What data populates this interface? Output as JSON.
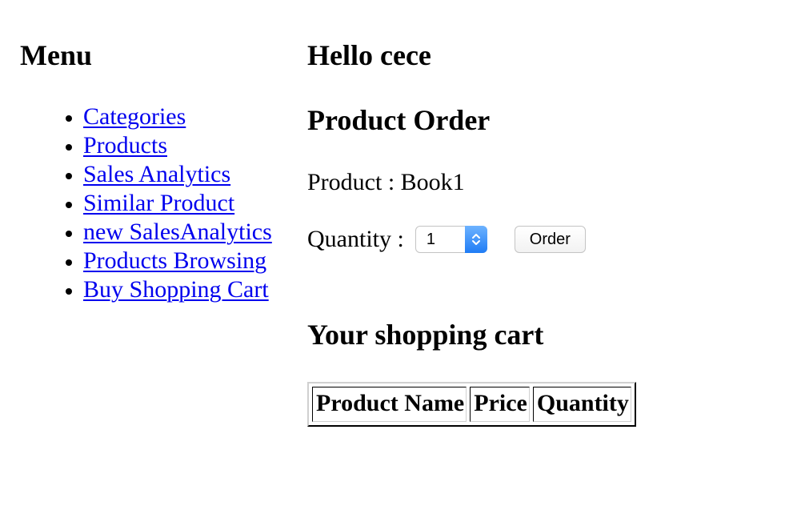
{
  "sidebar": {
    "title": "Menu",
    "items": [
      {
        "label": "Categories"
      },
      {
        "label": "Products"
      },
      {
        "label": "Sales Analytics"
      },
      {
        "label": "Similar Product"
      },
      {
        "label": "new SalesAnalytics"
      },
      {
        "label": "Products Browsing"
      },
      {
        "label": "Buy Shopping Cart"
      }
    ]
  },
  "main": {
    "greeting": "Hello cece",
    "order_title": "Product Order",
    "product_label": "Product : ",
    "product_value": "Book1",
    "quantity_label": "Quantity : ",
    "quantity_value": "1",
    "order_button": "Order",
    "cart_title": "Your shopping cart",
    "cart_columns": [
      "Product Name",
      "Price",
      "Quantity"
    ]
  },
  "colors": {
    "link": "#0000ee",
    "stepper": "#1f7cf5"
  }
}
